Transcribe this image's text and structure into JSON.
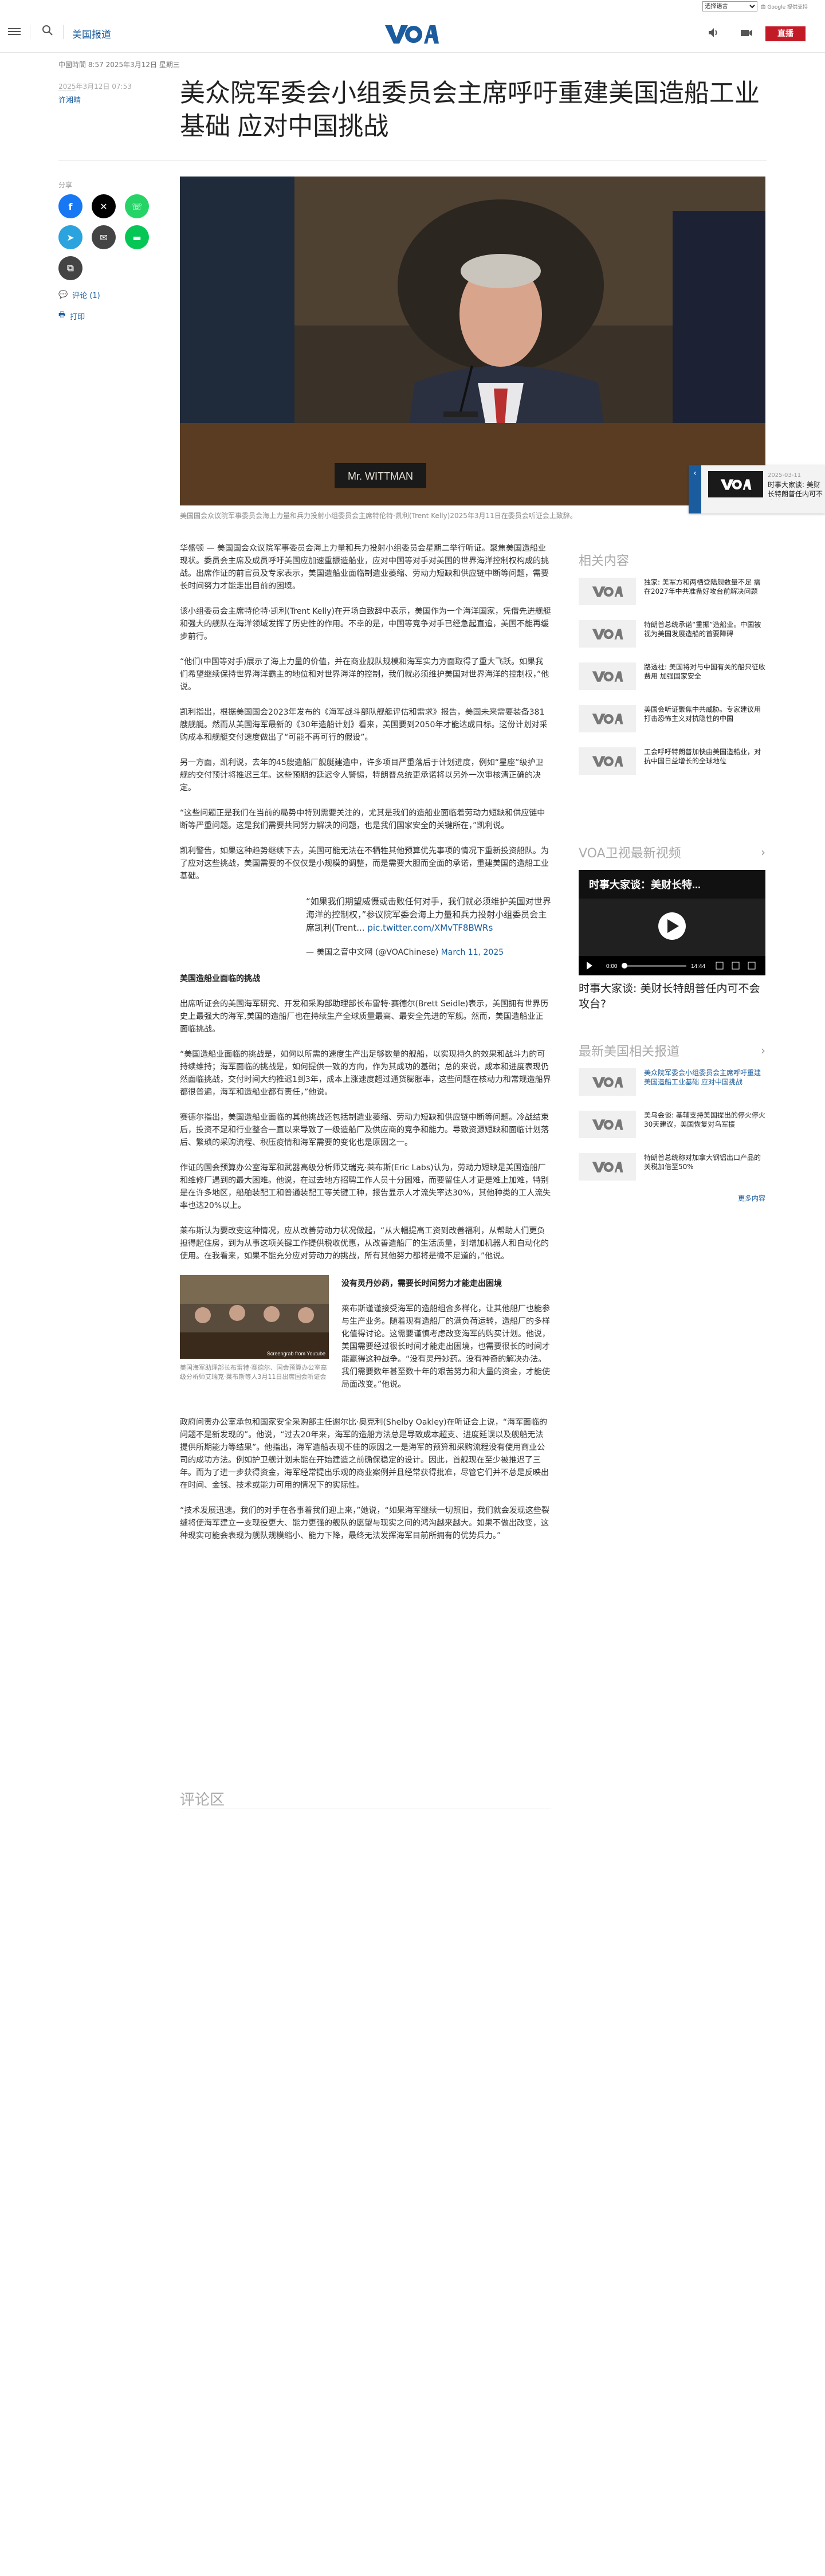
{
  "translate": {
    "select_label": "选择语言",
    "powered_by": "由 Google 提供支持"
  },
  "header": {
    "section": "美国报道",
    "logo_alt": "VOA",
    "live_label": "直播"
  },
  "article": {
    "updated": "中國時間 8:57 2025年3月12日 星期三",
    "date": "2025年3月12日 07:53",
    "byline": "许湘晴",
    "title": "美众院军委会小组委员会主席呼吁重建美国造船工业基础 应对中国挑战",
    "share_label": "分享",
    "comments_link": "评论 (1)",
    "print_link": "打印",
    "hero_nameplate": "Mr. WITTMAN",
    "hero_caption": "美国国会众议院军事委员会海上力量和兵力投射小组委员会主席特伦特·凯利(Trent Kelly)2025年3月11日在委员会听证会上致辞。",
    "paragraphs": [
      "华盛顿 — 美国国会众议院军事委员会海上力量和兵力投射小组委员会星期二举行听证。聚焦美国造船业现状。委员会主席及成员呼吁美国应加速重振造船业，应对中国等对手对美国的世界海洋控制权构成的挑战。出席作证的前官员及专家表示，美国造船业面临制造业萎缩、劳动力短缺和供应链中断等问题，需要长时间努力才能走出目前的困境。",
      "该小组委员会主席特伦特·凯利(Trent Kelly)在开场白致辞中表示，美国作为一个海洋国家，凭借先进舰艇和强大的舰队在海洋领域发挥了历史性的作用。不幸的是，中国等竞争对手已经急起直追，美国不能再缓步前行。",
      "“他们(中国等对手)展示了海上力量的价值，并在商业舰队规模和海军实力方面取得了重大飞跃。如果我们希望继续保持世界海洋霸主的地位和对世界海洋的控制，我们就必须维护美国对世界海洋的控制权，”他说。",
      "凯利指出，根据美国国会2023年发布的《海军战斗部队舰艇评估和需求》报告，美国未来需要装备381艘舰艇。然而从美国海军最新的《30年造船计划》看来，美国要到2050年才能达成目标。这份计划对采购成本和舰艇交付速度做出了“可能不再可行的假设”。",
      "另一方面，凯利说，去年的45艘造船厂舰艇建造中，许多项目严重落后于计划进度，例如“星座”级护卫舰的交付预计将推迟三年。这些预期的延迟令人警惕，特朗普总统更承诺将以另外一次审核清正确的决定。",
      "“这些问题正是我们在当前的局势中特别需要关注的，尤其是我们的造船业面临着劳动力短缺和供应链中断等严重问题。这是我们需要共同努力解决的问题，也是我们国家安全的关键所在，”凯利说。",
      "凯利警告，如果这种趋势继续下去，美国可能无法在不牺牲其他预算优先事项的情况下重新投资船队。为了应对这些挑战，美国需要的不仅仅是小规模的调整，而是需要大胆而全面的承诺，重建美国的造船工业基础。"
    ],
    "quote_text": "“如果我们期望威慑或击败任何对手，我们就必须维护美国对世界海洋的控制权，”参议院军委会海上力量和兵力投射小组委员会主席凯利(Trent...",
    "quote_link": "pic.twitter.com/XMvTF8BWRs",
    "quote_source": "— 美国之音中文网 (@VOAChinese)",
    "quote_date": "March 11, 2025",
    "subhead1": "美国造船业面临的挑战",
    "paragraphs2": [
      "出席听证会的美国海军研究、开发和采购部助理部长布雷特·赛德尔(Brett Seidle)表示，美国拥有世界历史上最强大的海军,美国的造船厂也在持续生产全球质量最高、最安全先进的军舰。然而，美国造船业正面临挑战。",
      "“美国造船业面临的挑战是，如何以所需的速度生产出足够数量的舰船，以实现持久的效果和战斗力的可持续维持；海军面临的挑战是，如何提供一致的方向，作为其成功的基础；总的来说，成本和进度表现仍然面临挑战，交付时间大约推迟1到3年，成本上涨速度超过通货膨胀率，这些问题在核动力和常规造船界都很普遍，海军和造船业都有责任，”他说。",
      "赛德尔指出，美国造船业面临的其他挑战还包括制造业萎缩、劳动力短缺和供应链中断等问题。冷战结束后，投资不足和行业整合一直以来导致了一级造船厂及供应商的竞争和能力。导致资源短缺和面临计划落后、繁琐的采购流程、积压疫情和海军需要的变化也是原因之一。",
      "作证的国会预算办公室海军和武器高级分析师艾瑞克·莱布斯(Eric Labs)认为，劳动力短缺是美国造船厂和维修厂遇到的最大困难。他说，在过去地方招聘工作人员十分困难，而要留住人才更是难上加难，特别是在许多地区，船舶装配工和普通装配工等关键工种，报告显示人才流失率达30%，其他种类的工人流失率也达20%以上。",
      "莱布斯认为要改变这种情况，应从改善劳动力状况做起，“从大幅提高工资到改善福利，从帮助人们更负担得起住房，到为从事这项关键工作提供税收优惠，从改善造船厂的生活质量，到增加机器人和自动化的使用。在我看来，如果不能充分应对劳动力的挑战，所有其他努力都将是微不足道的，”他说。"
    ],
    "inline_caption": "美国海军助理部长布雷特·赛德尔、国会预算办公室高级分析师艾瑞克·莱布斯等人3月11日出席国会听证会",
    "inline_overlay": "Screengrab from Youtube",
    "subhead2": "没有灵丹妙药，需要长时间努力才能走出困境",
    "photo_para": "莱布斯谨谨接受海军的造船组合多样化，让其他船厂也能参与生产业务。随着现有造船厂的满负荷运转，造船厂的多样化值得讨论。这需要谨慎考虑改变海军的购买计划。他说，美国需要经过很长时间才能走出困境，也需要很长的时间才能赢得这种战争。“没有灵丹妙药。没有神奇的解决办法。我们需要数年甚至数十年的艰苦努力和大量的资金，才能使局面改变。”他说。",
    "paragraphs3": [
      "政府问责办公室承包和国家安全采购部主任谢尔比·奥克利(Shelby Oakley)在听证会上说，“海军面临的问题不是新发现的”。他说，“过去20年来，海军的造船方法总是导致成本超支、进度延误以及舰船无法提供所期能力等结果”。他指出，海军造船表现不佳的原因之一是海军的预算和采购流程没有使用商业公司的成功方法。例如护卫舰计划未能在开始建造之前确保稳定的设计。因此，首舰现在至少被推迟了三年。而为了进一步获得资金，海军经常提出乐观的商业案例并且经常获得批准，尽管它们并不总是反映出在时间、金钱、技术或能力可用的情况下的实际性。",
      "“技术发展迅速。我们的对手在各事着我们迎上来，”她说，“如果海军继续一切照旧，我们就会发现这些裂缝将使海军建立一支现役更大、能力更强的舰队的愿望与现实之间的鸿沟越来越大。如果不做出改变，这种现实可能会表现为舰队规模缩小、能力下降，最终无法发挥海军目前所拥有的优势兵力。”"
    ],
    "comments_heading": "评论区"
  },
  "sidebar": {
    "related_title": "相关内容",
    "related": [
      {
        "text": "独家: 美军方和两栖登陆舰数量不足 需在2027年中共准备好攻台前解决问题"
      },
      {
        "text": "特朗普总统承诺“重振”造船业。中国被视为美国发展造船的首要障碍"
      },
      {
        "text": "路透社: 美国将对与中国有关的船只征收费用 加强国家安全"
      },
      {
        "text": "美国会听证聚焦中共威胁。专家建议用打击恐怖主义对抗隐性的中国"
      },
      {
        "text": "工会呼吁特朗普加快由美国造船业，对抗中国日益增长的全球地位"
      }
    ],
    "video_title": "VOA卫视最新视频",
    "video_overlay": "时事大家谈：美财长特...",
    "video_time_start": "0:00",
    "video_time_end": "14:44",
    "video_caption": "时事大家谈: 美财长特朗普任内可不会攻台?",
    "latest_title": "最新美国相关报道",
    "latest": [
      {
        "text": "美众院军委会小组委员会主席呼吁重建美国造船工业基础 应对中国挑战"
      },
      {
        "text": "美乌会谈: 基辅支持美国提出的停火停火30天建议，美国恢复对乌军援"
      },
      {
        "text": "特朗普总统称对加拿大钢铝出口产品的关税加倍至50%"
      }
    ],
    "more_label": "更多内容"
  },
  "floating_player": {
    "date": "2025-03-11",
    "text": "时事大家谈: 美财长特朗普任内可不会攻台?"
  },
  "colors": {
    "brand_blue": "#1a5c9e",
    "live_red": "#c21b27"
  }
}
